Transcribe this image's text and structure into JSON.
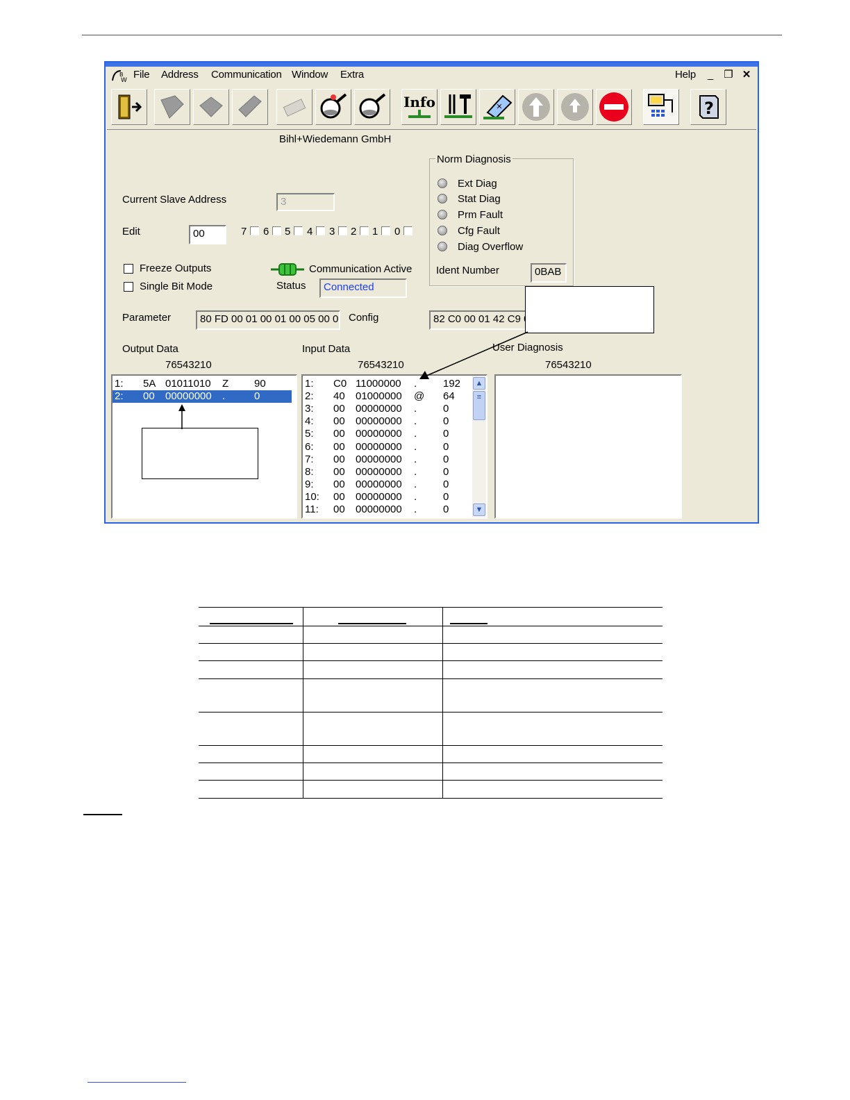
{
  "menu": {
    "file": "File",
    "address": "Address",
    "communication": "Communication",
    "window": "Window",
    "extra": "Extra",
    "help": "Help"
  },
  "toolbar": {
    "info_label": "Info"
  },
  "company": "Bihl+Wiedemann GmbH",
  "slave": {
    "current_label": "Current Slave Address",
    "current_value": "3",
    "edit_label": "Edit",
    "edit_value": "00",
    "bits": [
      "7",
      "6",
      "5",
      "4",
      "3",
      "2",
      "1",
      "0"
    ]
  },
  "options": {
    "freeze_outputs": "Freeze Outputs",
    "single_bit_mode": "Single Bit Mode"
  },
  "communication": {
    "active_label": "Communication Active",
    "status_label": "Status",
    "status_value": "Connected"
  },
  "norm_diagnosis": {
    "title": "Norm Diagnosis",
    "items": [
      "Ext Diag",
      "Stat Diag",
      "Prm Fault",
      "Cfg Fault",
      "Diag Overflow"
    ],
    "ident_label": "Ident Number",
    "ident_value": "0BAB"
  },
  "parameter": {
    "label": "Parameter",
    "value": "80 FD 00 01 00 01 00 05 00 0"
  },
  "config": {
    "label": "Config",
    "value": "82 C0 00 01 42 C9 0"
  },
  "output_data": {
    "label": "Output Data",
    "header": "76543210",
    "rows": [
      {
        "idx": "1:",
        "hex": "5A",
        "bin": "01011010",
        "chr": "Z",
        "dec": "90"
      },
      {
        "idx": "2:",
        "hex": "00",
        "bin": "00000000",
        "chr": ".",
        "dec": "0"
      }
    ]
  },
  "input_data": {
    "label": "Input Data",
    "header": "76543210",
    "rows": [
      {
        "idx": "1:",
        "hex": "C0",
        "bin": "11000000",
        "chr": ".",
        "dec": "192"
      },
      {
        "idx": "2:",
        "hex": "40",
        "bin": "01000000",
        "chr": "@",
        "dec": "64"
      },
      {
        "idx": "3:",
        "hex": "00",
        "bin": "00000000",
        "chr": ".",
        "dec": "0"
      },
      {
        "idx": "4:",
        "hex": "00",
        "bin": "00000000",
        "chr": ".",
        "dec": "0"
      },
      {
        "idx": "5:",
        "hex": "00",
        "bin": "00000000",
        "chr": ".",
        "dec": "0"
      },
      {
        "idx": "6:",
        "hex": "00",
        "bin": "00000000",
        "chr": ".",
        "dec": "0"
      },
      {
        "idx": "7:",
        "hex": "00",
        "bin": "00000000",
        "chr": ".",
        "dec": "0"
      },
      {
        "idx": "8:",
        "hex": "00",
        "bin": "00000000",
        "chr": ".",
        "dec": "0"
      },
      {
        "idx": "9:",
        "hex": "00",
        "bin": "00000000",
        "chr": ".",
        "dec": "0"
      },
      {
        "idx": "10:",
        "hex": "00",
        "bin": "00000000",
        "chr": ".",
        "dec": "0"
      },
      {
        "idx": "11:",
        "hex": "00",
        "bin": "00000000",
        "chr": ".",
        "dec": "0"
      }
    ]
  },
  "user_diagnosis": {
    "label": "User Diagnosis",
    "header": "76543210"
  },
  "colors": {
    "window_border": "#2a63e8",
    "selection": "#316ac5",
    "status_text": "#1a3dff",
    "stop_red": "#e8001c",
    "connector_green": "#3cc43c"
  }
}
